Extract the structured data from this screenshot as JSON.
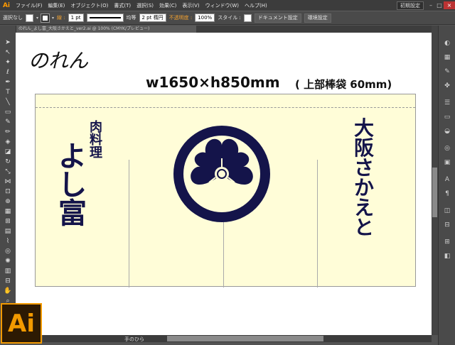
{
  "app": {
    "logo": "Ai"
  },
  "menu": [
    "ファイル(F)",
    "編集(E)",
    "オブジェクト(O)",
    "書式(T)",
    "選択(S)",
    "効果(C)",
    "表示(V)",
    "ウィンドウ(W)",
    "ヘルプ(H)"
  ],
  "workspace": {
    "label": "初期設定"
  },
  "control": {
    "selection": "選択なし",
    "stroke_label": "線 :",
    "stroke_weight": "1 pt",
    "profile_label": "均等",
    "brush": "2 pt 楕円",
    "opacity_label": "不透明度 :",
    "opacity_value": "100%",
    "style_label": "スタイル :",
    "doc_setup": "ドキュメント設定",
    "prefs": "環境設定"
  },
  "doc_tab": "のれん_よし富_大阪さかえと_ver2.ai @ 100% (CMYK/プレビュー)",
  "status": {
    "tool": "手のひら"
  },
  "artwork": {
    "title": "のれん",
    "dimensions": "w1650×h850mm",
    "note": "( 上部棒袋 60mm)",
    "left_small": [
      "肉",
      "料",
      "理"
    ],
    "left_big": [
      "よ",
      "し",
      "富"
    ],
    "right": [
      "大",
      "阪",
      "さ",
      "か",
      "え",
      "と"
    ],
    "ink_color": "#14144a",
    "fabric_color": "#fffdd8"
  },
  "colors": {
    "accent": "#f39a00",
    "menubar": "#3c3c3c",
    "panel": "#4a4a4a"
  }
}
